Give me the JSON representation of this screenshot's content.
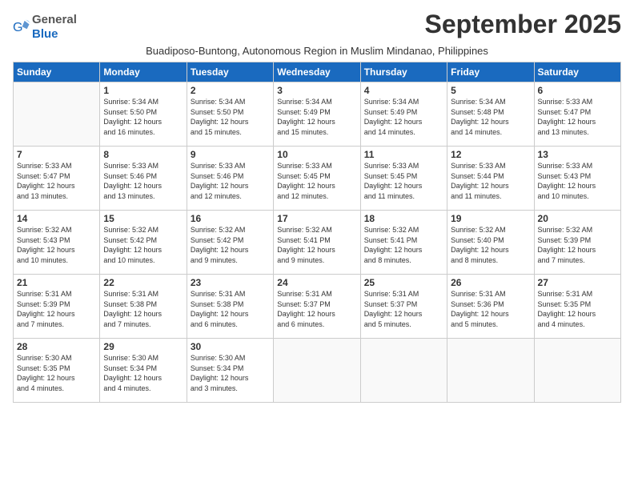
{
  "logo": {
    "general": "General",
    "blue": "Blue"
  },
  "title": "September 2025",
  "subtitle": "Buadiposo-Buntong, Autonomous Region in Muslim Mindanao, Philippines",
  "days_header": [
    "Sunday",
    "Monday",
    "Tuesday",
    "Wednesday",
    "Thursday",
    "Friday",
    "Saturday"
  ],
  "weeks": [
    [
      {
        "day": "",
        "info": ""
      },
      {
        "day": "1",
        "info": "Sunrise: 5:34 AM\nSunset: 5:50 PM\nDaylight: 12 hours\nand 16 minutes."
      },
      {
        "day": "2",
        "info": "Sunrise: 5:34 AM\nSunset: 5:50 PM\nDaylight: 12 hours\nand 15 minutes."
      },
      {
        "day": "3",
        "info": "Sunrise: 5:34 AM\nSunset: 5:49 PM\nDaylight: 12 hours\nand 15 minutes."
      },
      {
        "day": "4",
        "info": "Sunrise: 5:34 AM\nSunset: 5:49 PM\nDaylight: 12 hours\nand 14 minutes."
      },
      {
        "day": "5",
        "info": "Sunrise: 5:34 AM\nSunset: 5:48 PM\nDaylight: 12 hours\nand 14 minutes."
      },
      {
        "day": "6",
        "info": "Sunrise: 5:33 AM\nSunset: 5:47 PM\nDaylight: 12 hours\nand 13 minutes."
      }
    ],
    [
      {
        "day": "7",
        "info": "Sunrise: 5:33 AM\nSunset: 5:47 PM\nDaylight: 12 hours\nand 13 minutes."
      },
      {
        "day": "8",
        "info": "Sunrise: 5:33 AM\nSunset: 5:46 PM\nDaylight: 12 hours\nand 13 minutes."
      },
      {
        "day": "9",
        "info": "Sunrise: 5:33 AM\nSunset: 5:46 PM\nDaylight: 12 hours\nand 12 minutes."
      },
      {
        "day": "10",
        "info": "Sunrise: 5:33 AM\nSunset: 5:45 PM\nDaylight: 12 hours\nand 12 minutes."
      },
      {
        "day": "11",
        "info": "Sunrise: 5:33 AM\nSunset: 5:45 PM\nDaylight: 12 hours\nand 11 minutes."
      },
      {
        "day": "12",
        "info": "Sunrise: 5:33 AM\nSunset: 5:44 PM\nDaylight: 12 hours\nand 11 minutes."
      },
      {
        "day": "13",
        "info": "Sunrise: 5:33 AM\nSunset: 5:43 PM\nDaylight: 12 hours\nand 10 minutes."
      }
    ],
    [
      {
        "day": "14",
        "info": "Sunrise: 5:32 AM\nSunset: 5:43 PM\nDaylight: 12 hours\nand 10 minutes."
      },
      {
        "day": "15",
        "info": "Sunrise: 5:32 AM\nSunset: 5:42 PM\nDaylight: 12 hours\nand 10 minutes."
      },
      {
        "day": "16",
        "info": "Sunrise: 5:32 AM\nSunset: 5:42 PM\nDaylight: 12 hours\nand 9 minutes."
      },
      {
        "day": "17",
        "info": "Sunrise: 5:32 AM\nSunset: 5:41 PM\nDaylight: 12 hours\nand 9 minutes."
      },
      {
        "day": "18",
        "info": "Sunrise: 5:32 AM\nSunset: 5:41 PM\nDaylight: 12 hours\nand 8 minutes."
      },
      {
        "day": "19",
        "info": "Sunrise: 5:32 AM\nSunset: 5:40 PM\nDaylight: 12 hours\nand 8 minutes."
      },
      {
        "day": "20",
        "info": "Sunrise: 5:32 AM\nSunset: 5:39 PM\nDaylight: 12 hours\nand 7 minutes."
      }
    ],
    [
      {
        "day": "21",
        "info": "Sunrise: 5:31 AM\nSunset: 5:39 PM\nDaylight: 12 hours\nand 7 minutes."
      },
      {
        "day": "22",
        "info": "Sunrise: 5:31 AM\nSunset: 5:38 PM\nDaylight: 12 hours\nand 7 minutes."
      },
      {
        "day": "23",
        "info": "Sunrise: 5:31 AM\nSunset: 5:38 PM\nDaylight: 12 hours\nand 6 minutes."
      },
      {
        "day": "24",
        "info": "Sunrise: 5:31 AM\nSunset: 5:37 PM\nDaylight: 12 hours\nand 6 minutes."
      },
      {
        "day": "25",
        "info": "Sunrise: 5:31 AM\nSunset: 5:37 PM\nDaylight: 12 hours\nand 5 minutes."
      },
      {
        "day": "26",
        "info": "Sunrise: 5:31 AM\nSunset: 5:36 PM\nDaylight: 12 hours\nand 5 minutes."
      },
      {
        "day": "27",
        "info": "Sunrise: 5:31 AM\nSunset: 5:35 PM\nDaylight: 12 hours\nand 4 minutes."
      }
    ],
    [
      {
        "day": "28",
        "info": "Sunrise: 5:30 AM\nSunset: 5:35 PM\nDaylight: 12 hours\nand 4 minutes."
      },
      {
        "day": "29",
        "info": "Sunrise: 5:30 AM\nSunset: 5:34 PM\nDaylight: 12 hours\nand 4 minutes."
      },
      {
        "day": "30",
        "info": "Sunrise: 5:30 AM\nSunset: 5:34 PM\nDaylight: 12 hours\nand 3 minutes."
      },
      {
        "day": "",
        "info": ""
      },
      {
        "day": "",
        "info": ""
      },
      {
        "day": "",
        "info": ""
      },
      {
        "day": "",
        "info": ""
      }
    ]
  ]
}
